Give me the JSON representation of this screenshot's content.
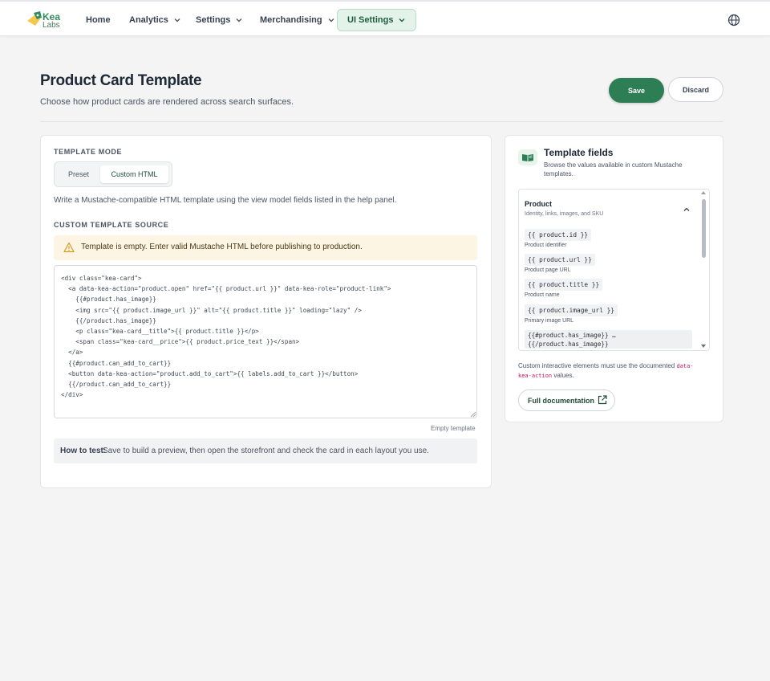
{
  "app": {
    "brand_line1": "Kea",
    "brand_line2": "Labs"
  },
  "nav": {
    "items": [
      {
        "label": "Home",
        "has_menu": false
      },
      {
        "label": "Analytics",
        "has_menu": true
      },
      {
        "label": "Settings",
        "has_menu": true
      },
      {
        "label": "Merchandising",
        "has_menu": true
      },
      {
        "label": "UI Settings",
        "has_menu": true,
        "active": true
      }
    ],
    "language_icon": "globe-icon"
  },
  "header": {
    "title": "Product Card Template",
    "subtitle": "Choose how product cards are rendered across search surfaces.",
    "save_label": "Save",
    "discard_label": "Discard"
  },
  "template": {
    "mode_label": "TEMPLATE MODE",
    "modes": [
      "Preset",
      "Custom HTML"
    ],
    "selected_mode": "Custom HTML",
    "description": "Write a Mustache-compatible HTML template using the view model fields listed in the help panel.",
    "source_label": "CUSTOM TEMPLATE SOURCE",
    "warning": "Template is empty. Enter valid Mustache HTML before publishing to production.",
    "source": "<div class=\"kea-card\">\n  <a data-kea-action=\"product.open\" href=\"{{ product.url }}\" data-kea-role=\"product-link\">\n    {{#product.has_image}}\n    <img src=\"{{ product.image_url }}\" alt=\"{{ product.title }}\" loading=\"lazy\" />\n    {{/product.has_image}}\n    <p class=\"kea-card__title\">{{ product.title }}</p>\n    <span class=\"kea-card__price\">{{ product.price_text }}</span>\n  </a>\n  {{#product.can_add_to_cart}}\n  <button data-kea-action=\"product.add_to_cart\">{{ labels.add_to_cart }}</button>\n  {{/product.can_add_to_cart}}\n</div>",
    "source_hint": "Empty template",
    "howto_label": "How to test:",
    "howto_text": "Save to build a preview, then open the storefront and check the card in each layout you use."
  },
  "help": {
    "title": "Template fields",
    "subtitle": "Browse the values available in custom Mustache templates.",
    "group": {
      "title": "Product",
      "subtitle": "Identity, links, images, and SKU",
      "fields": [
        {
          "token": "{{ product.id }}",
          "desc": "Product identifier"
        },
        {
          "token": "{{ product.url }}",
          "desc": "Product page URL"
        },
        {
          "token": "{{ product.title }}",
          "desc": "Product name"
        },
        {
          "token": "{{ product.image_url }}",
          "desc": "Primary image URL"
        }
      ],
      "block_token": "{{#product.has_image}} …\n{{/product.has_image}}"
    },
    "note_prefix": "Custom interactive elements must use the documented ",
    "note_code": "data-kea-action",
    "note_suffix": " values.",
    "docs_label": "Full documentation"
  },
  "colors": {
    "accent": "#2d7e55",
    "warning_bg": "#fdf5e3",
    "active_nav_bg": "#e3f3ea"
  }
}
